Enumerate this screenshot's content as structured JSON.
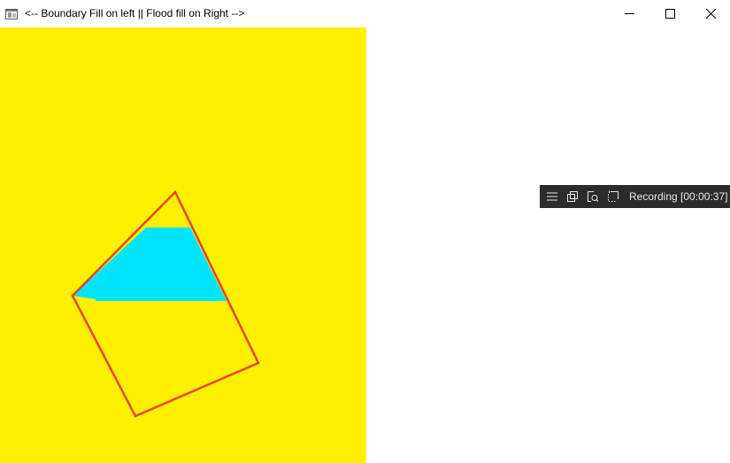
{
  "window": {
    "title": "<-- Boundary Fill on left || Flood fill on Right -->",
    "icon": "app-window-icon"
  },
  "title_buttons": {
    "minimize_icon": "minimize-icon",
    "maximize_icon": "maximize-icon",
    "close_icon": "close-icon"
  },
  "canvas": {
    "background_color": "#ffef00",
    "boundary_color": "#ee4422",
    "fill_color": "#00e5ff"
  },
  "recording_toolbar": {
    "icons": [
      "menu-icon",
      "copy-icon",
      "zoom-region-icon",
      "capture-region-icon"
    ],
    "status_text": "Recording [00:00:37]"
  }
}
